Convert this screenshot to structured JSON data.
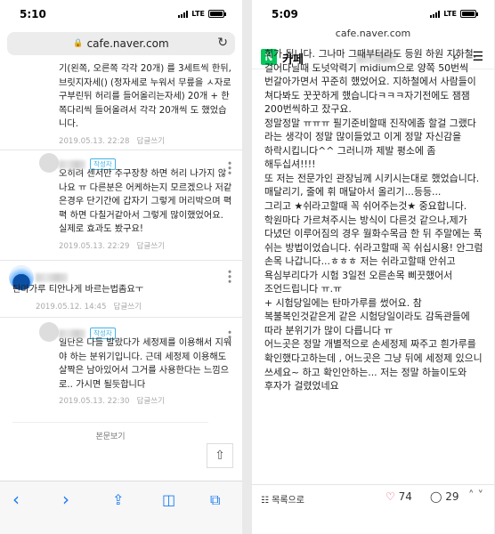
{
  "left": {
    "status_time": "5:10",
    "network": "LTE",
    "url": "cafe.naver.com",
    "intro_text": "기(왼쪽, 오른쪽 각각 20개) 를 3세트씩 한뒤, 브릿지자세() (정자세로 누워서 무릎을 ㅅ자로 구부린뒤 허리를 들어올리는자세) 20개 + 한쪽다리씩 들어올려서 각각 20개씩 도 했었습니다.",
    "intro_date": "2019.05.13. 22:28",
    "reply_label": "답글쓰기",
    "comments": [
      {
        "badge": "작성자",
        "text": "오히려 센서만 주구장창 하면 허리 나가지 않나요 ㅠ 다른분은 어케하는지 모르겠으나 저같은경우 단기간에 갑자기 그렇게 머리박으며 펵펵 하면 다칠거같아서 그렇게 많이했었어요. 실제로 효과도 봤구요!",
        "date": "2019.05.13. 22:29"
      },
      {
        "badge": "",
        "text": "탄마가루 티안나게 바르는법좀요ㅜ",
        "date": "2019.05.12. 14:45"
      },
      {
        "badge": "작성자",
        "text": "일단은 다들 발랐다가 세정제를 이용해서 지워야 하는 분위기입니다. 근데 세정제 이용해도 살짝은 남아있어서 그거를 사용한다는 느낌으로.. 가시면 될듯합니다",
        "date": "2019.05.13. 22:30"
      }
    ],
    "more_label": "본문보기",
    "scroll_top_icon": "arrow-up-icon",
    "toolbar_icons": [
      "back-icon",
      "forward-icon",
      "share-icon",
      "bookmarks-icon",
      "tabs-icon"
    ]
  },
  "right": {
    "status_time": "5:09",
    "network": "LTE",
    "url": "cafe.naver.com",
    "logo": "N",
    "cafe_label": "카페",
    "paragraphs": [
      "회가 됩니다. 그나마 그때부터라도 등원 하원 지하철, 걸어다닐때 도넛악력기 midium으로 양쪽 50번씩 번갈아가면서 꾸준히 했었어요. 지하철에서 사람들이 쳐다봐도 꿋꿋하게 했습니다ㅋㅋㅋ자기전에도 잼잼 200번씩하고 잤구요.",
      "정말정말 ㅠㅠㅠ 필기준비할때 진작에좀 할걸 그랬다 라는 생각이 정말 많이들었고 이게 정말 자신감을 하락시킵니다^^ 그러니까 제발 평소에 좀 해두십셔!!!!",
      "또 저는 전문가인 관장님께 시키시는대로 했었습니다. 매달리기, 줄에 휘 매달아서 올리기...등등...",
      "그리고 ★쉬라고할때 꼭 쉬어주는것★ 중요합니다. 학원마다 가르쳐주시는 방식이 다른것 같으나,제가 다녔던 이루어짐의 경우 월화수목금 한 뒤 주말에는 푹 쉬는 방법이었습니다. 쉬라고할때 꼭 쉬십시용! 안그럼 손목 나갑니다...ㅎㅎㅎ 저는 쉬라고할때 안쉬고 욕심부리다가 시험 3일전 오른손목 삐끗했어서 조언드립니다 ㅠ.ㅠ",
      "+ 시험당일에는 탄마가루를 썼어요. 참 복불복인것같은게 같은 시험당일이라도 감독관들에 따라 분위기가 많이 다릅니다 ㅠ",
      "어느곳은 정말 개별적으로 손세정제 짜주고 흰가루를 확인했다고하는데 , 어느곳은 그냥 뒤에 세정제 있으니 쓰세요~ 하고 확인안하는... 저는 정말 하늘이도와 후자가 걸렸었네요"
    ],
    "list_label": "목록으로",
    "like_count": "74",
    "comment_count": "29",
    "accent_green": "#03c75a",
    "like_color": "#e0455a"
  }
}
